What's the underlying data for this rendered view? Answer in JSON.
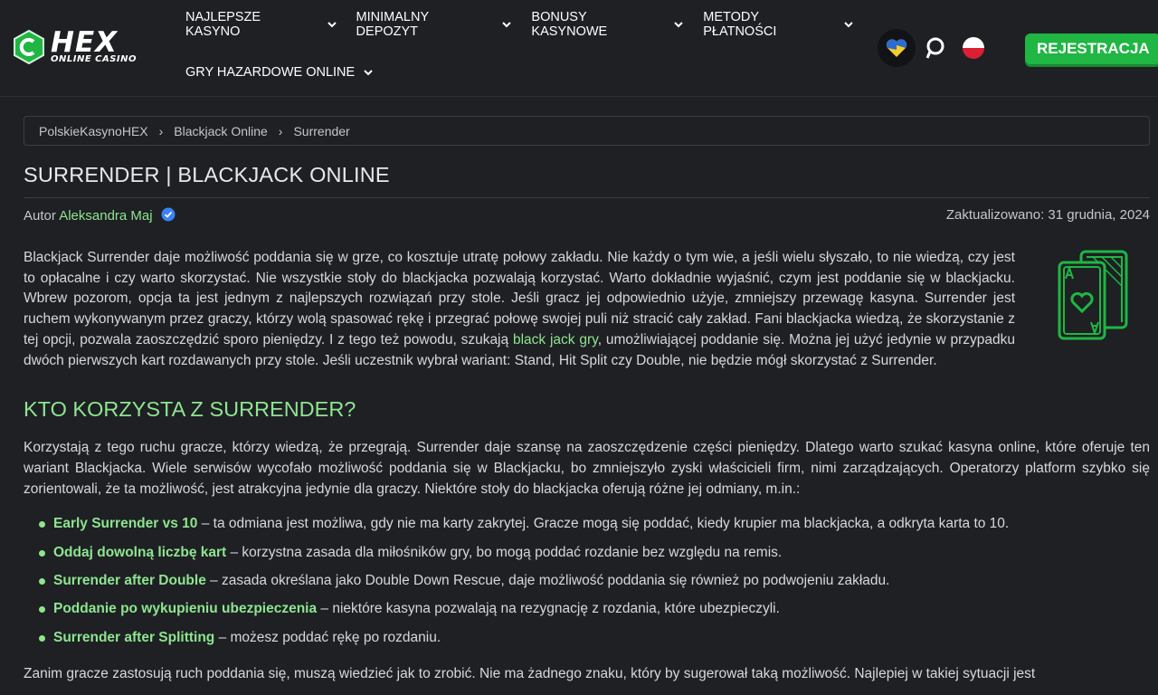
{
  "brand": {
    "name": "HEX",
    "tagline": "ONLINE CASINO"
  },
  "nav": {
    "items": [
      {
        "label": "NAJLEPSZE KASYNO"
      },
      {
        "label": "MINIMALNY DEPOZYT"
      },
      {
        "label": "BONUSY KASYNOWE"
      },
      {
        "label": "METODY PŁATNOŚCI"
      },
      {
        "label": "GRY HAZARDOWE ONLINE"
      }
    ]
  },
  "header": {
    "icons": [
      "ukraine-heart-icon",
      "search-icon",
      "poland-flag-icon"
    ],
    "register_label": "REJESTRACJA"
  },
  "breadcrumb": [
    "PolskieKasynoHEX",
    "Blackjack Online",
    "Surrender"
  ],
  "article": {
    "title": "SURRENDER | BLACKJACK ONLINE",
    "author_prefix": "Autor",
    "author_name": "Aleksandra Maj",
    "updated": "Zaktualizowano: 31 grudnia, 2024",
    "intro_before_link": "Blackjack Surrender daje możliwość poddania się w grze, co kosztuje utratę połowy zakładu. Nie każdy o tym wie, a jeśli wielu słyszało, to nie wiedzą, czy jest to opłacalne i czy warto skorzystać. Nie wszystkie stoły do blackjacka pozwalają korzystać. Warto dokładnie wyjaśnić, czym jest poddanie się w blackjacku. Wbrew pozorom, opcja ta jest jednym z najlepszych rozwiązań przy stole. Jeśli gracz jej odpowiednio użyje, zmniejszy przewagę kasyna. Surrender jest ruchem wykonywanym przez graczy, którzy wolą spasować rękę i przegrać połowę swojej puli niż stracić cały zakład. Fani blackjacka wiedzą, że skorzystanie z tej opcji, pozwala zaoszczędzić sporo pieniędzy. I z tego też powodu, szukają ",
    "intro_link": "black jack gry",
    "intro_after_link": ", umożliwiającej poddanie się. Można jej użyć jedynie w przypadku dwóch pierwszych kart rozdawanych przy stole. Jeśli uczestnik wybrał wariant: Stand, Hit Split czy Double, nie będzie mógł skorzystać z Surrender.",
    "section_heading": "KTO KORZYSTA Z SURRENDER?",
    "section_text": "Korzystają z tego ruchu gracze, którzy wiedzą, że przegrają. Surrender daje szansę na zaoszczędzenie części pieniędzy. Dlatego warto szukać kasyna online, które oferuje ten wariant Blackjacka. Wiele serwisów wycofało możliwość poddania się w Blackjacku, bo zmniejszyło zyski właścicieli firm, nimi zarządzających. Operatorzy platform szybko się zorientowali, że ta możliwość, jest atrakcyjna jedynie dla graczy. Niektóre stoły do blackjacka oferują różne jej odmiany, m.in.:",
    "variants": [
      {
        "name": "Early Surrender vs 10",
        "desc": " – ta odmiana jest możliwa, gdy nie ma karty zakrytej. Gracze mogą się poddać, kiedy krupier ma blackjacka, a odkryta karta to 10."
      },
      {
        "name": "Oddaj dowolną liczbę kart",
        "desc": " – korzystna zasada dla miłośników gry, bo mogą poddać rozdanie bez względu na remis."
      },
      {
        "name": "Surrender after Double",
        "desc": " – zasada określana jako Double Down Rescue, daje możliwość poddania się również po podwojeniu zakładu."
      },
      {
        "name": "Poddanie po wykupieniu ubezpieczenia",
        "desc": " – niektóre kasyna pozwalają na rezygnację z rozdania, które ubezpieczyli."
      },
      {
        "name": "Surrender after Splitting",
        "desc": " – możesz poddać rękę po rozdaniu."
      }
    ],
    "closing_text": "Zanim gracze zastosują ruch poddania się, muszą wiedzieć jak to zrobić. Nie ma żadnego znaku, który by sugerował taką możliwość. Najlepiej w takiej sytuacji jest"
  },
  "colors": {
    "accent": "#8ee58f",
    "button": "#1fb643",
    "background": "#1e2024"
  }
}
